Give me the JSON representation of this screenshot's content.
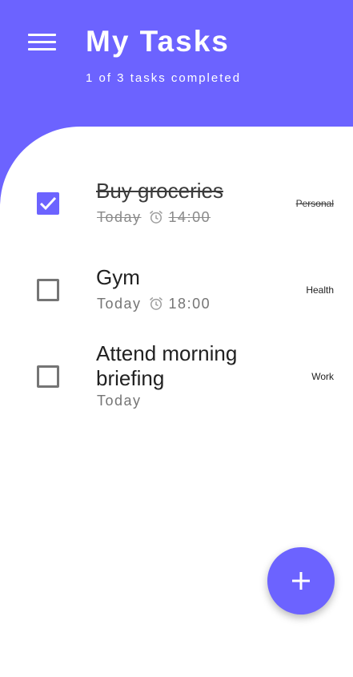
{
  "header": {
    "title": "My Tasks",
    "subtitle": "1 of 3 tasks completed",
    "menu_icon": "menu-icon",
    "background_color": "#6c63ff"
  },
  "tasks": [
    {
      "title": "Buy groceries",
      "date": "Today",
      "time": "14:00",
      "category": "Personal",
      "completed": true,
      "alarm_icon": "alarm-icon"
    },
    {
      "title": "Gym",
      "date": "Today",
      "time": "18:00",
      "category": "Health",
      "completed": false,
      "alarm_icon": "alarm-icon"
    },
    {
      "title": "Attend morning briefing",
      "date": "Today",
      "time": "",
      "category": "Work",
      "completed": false
    }
  ],
  "fab": {
    "icon": "plus-icon"
  },
  "colors": {
    "accent": "#6c63ff",
    "checkbox_border": "#757575",
    "meta_text": "#757575"
  }
}
